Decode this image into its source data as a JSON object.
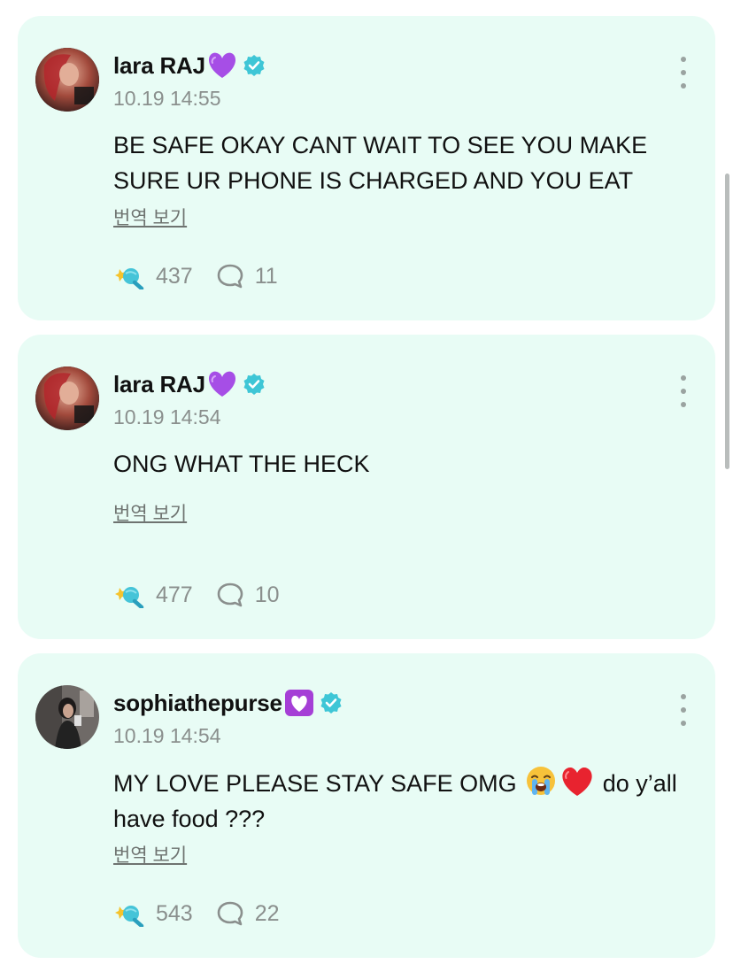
{
  "posts": [
    {
      "username": "lara RAJ",
      "badge_emoji": "purple-heart",
      "verified": true,
      "timestamp": "10.19 14:55",
      "text": "BE SAFE OKAY CANT WAIT TO SEE YOU MAKE SURE UR PHONE IS CHARGED AND YOU EAT",
      "translate_label": "번역 보기",
      "reactions": "437",
      "comments": "11"
    },
    {
      "username": "lara RAJ",
      "badge_emoji": "purple-heart",
      "verified": true,
      "timestamp": "10.19 14:54",
      "text": "ONG WHAT THE HECK",
      "translate_label": "번역 보기",
      "reactions": "477",
      "comments": "10"
    },
    {
      "username": "sophiathepurse",
      "badge_emoji": "heart-decoration",
      "verified": true,
      "timestamp": "10.19 14:54",
      "text_before": "MY LOVE PLEASE STAY SAFE OMG",
      "text_emojis": [
        "loudly-crying-face",
        "red-heart"
      ],
      "text_after": "do y’all have food ???",
      "translate_label": "번역 보기",
      "reactions": "543",
      "comments": "22"
    }
  ],
  "colors": {
    "card_background": "#e8fcf5",
    "verified_badge": "#3ec6d6",
    "secondary_text": "#8a8f8d"
  }
}
